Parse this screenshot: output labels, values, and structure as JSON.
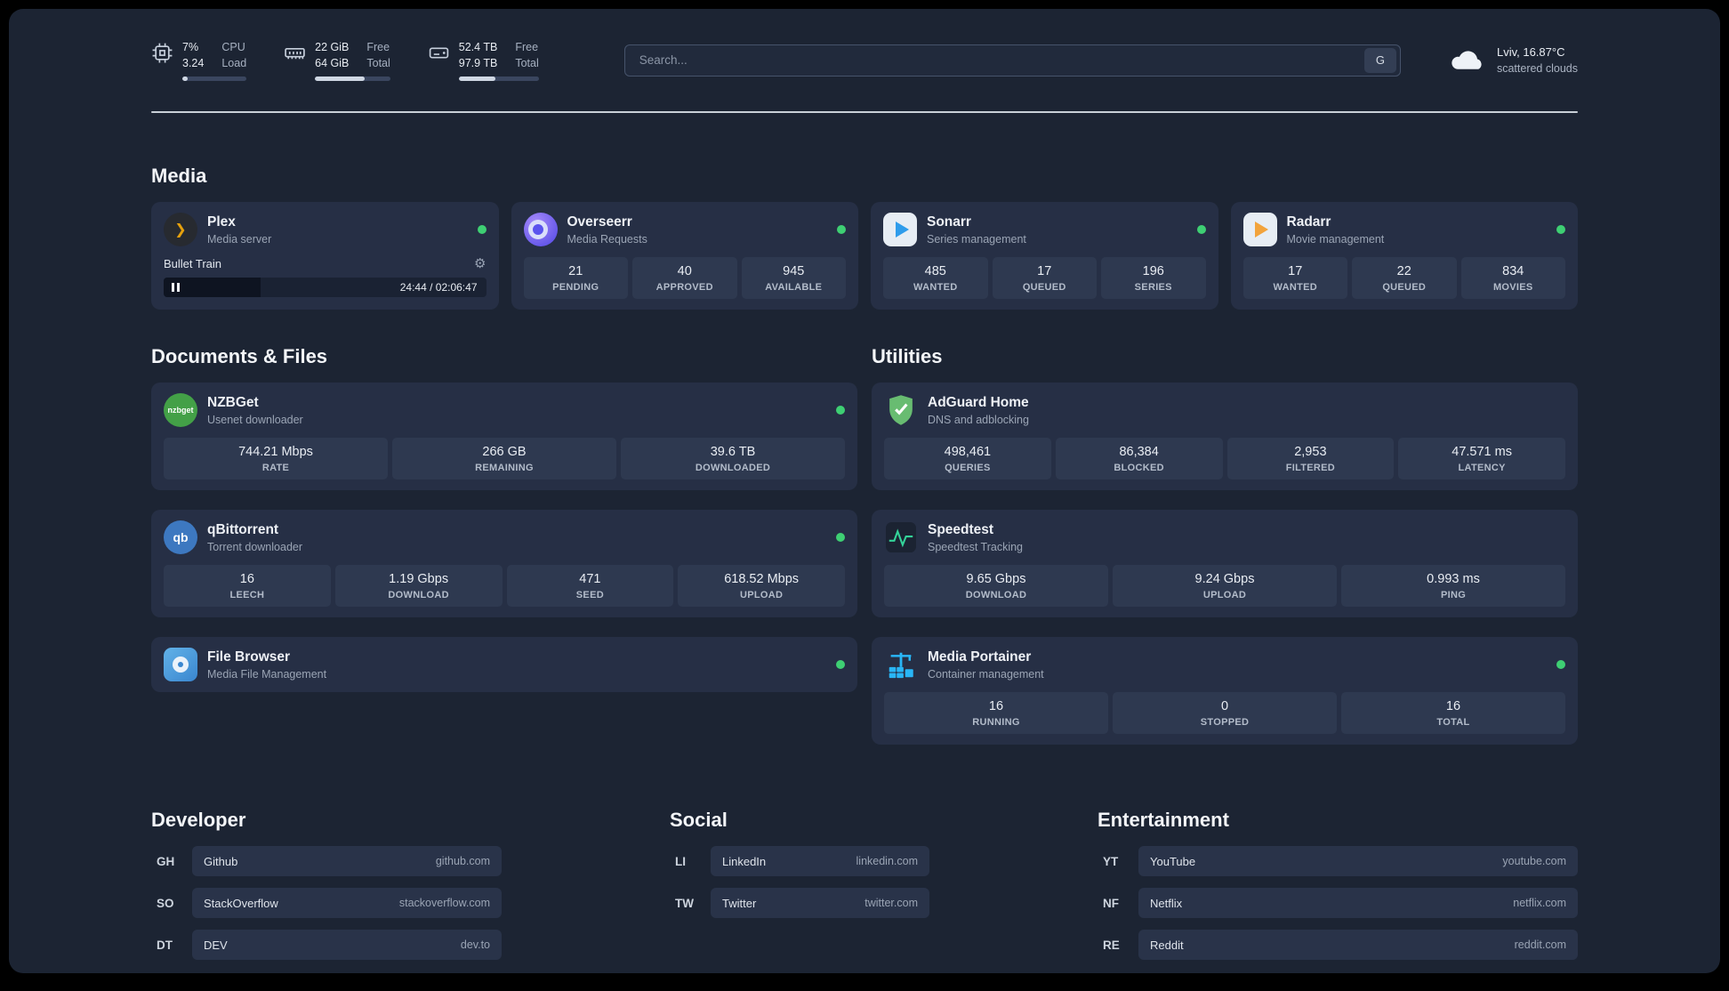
{
  "colors": {
    "background": "#1c2433",
    "card": "#262f45",
    "stat_box": "#2e3950",
    "status_online": "#3ecf73",
    "plex_accent": "#e5a00d",
    "adguard_green": "#68bc71",
    "portainer_blue": "#29b6f6"
  },
  "icons": {
    "gear": "⚙",
    "plex_glyph": "❯",
    "nzbget_text": "nzbget",
    "qbittorrent_text": "qb"
  },
  "topbar": {
    "cpu": {
      "value1": "7%",
      "value2": "3.24",
      "label1": "CPU",
      "label2": "Load"
    },
    "memory": {
      "value1": "22 GiB",
      "value2": "64 GiB",
      "label1": "Free",
      "label2": "Total"
    },
    "disk": {
      "value1": "52.4 TB",
      "value2": "97.9 TB",
      "label1": "Free",
      "label2": "Total"
    },
    "search": {
      "placeholder": "Search...",
      "button": "G"
    },
    "weather": {
      "location": "Lviv, 16.87°C",
      "condition": "scattered clouds"
    }
  },
  "sections": {
    "media": {
      "title": "Media",
      "plex": {
        "name": "Plex",
        "subtitle": "Media server",
        "player": {
          "track": "Bullet Train",
          "time": "24:44 / 02:06:47"
        }
      },
      "overseerr": {
        "name": "Overseerr",
        "subtitle": "Media Requests",
        "stats": [
          {
            "value": "21",
            "label": "PENDING"
          },
          {
            "value": "40",
            "label": "APPROVED"
          },
          {
            "value": "945",
            "label": "AVAILABLE"
          }
        ]
      },
      "sonarr": {
        "name": "Sonarr",
        "subtitle": "Series management",
        "stats": [
          {
            "value": "485",
            "label": "WANTED"
          },
          {
            "value": "17",
            "label": "QUEUED"
          },
          {
            "value": "196",
            "label": "SERIES"
          }
        ]
      },
      "radarr": {
        "name": "Radarr",
        "subtitle": "Movie management",
        "stats": [
          {
            "value": "17",
            "label": "WANTED"
          },
          {
            "value": "22",
            "label": "QUEUED"
          },
          {
            "value": "834",
            "label": "MOVIES"
          }
        ]
      }
    },
    "documents": {
      "title": "Documents & Files",
      "nzbget": {
        "name": "NZBGet",
        "subtitle": "Usenet downloader",
        "stats": [
          {
            "value": "744.21 Mbps",
            "label": "RATE"
          },
          {
            "value": "266 GB",
            "label": "REMAINING"
          },
          {
            "value": "39.6 TB",
            "label": "DOWNLOADED"
          }
        ]
      },
      "qbittorrent": {
        "name": "qBittorrent",
        "subtitle": "Torrent downloader",
        "stats": [
          {
            "value": "16",
            "label": "LEECH"
          },
          {
            "value": "1.19 Gbps",
            "label": "DOWNLOAD"
          },
          {
            "value": "471",
            "label": "SEED"
          },
          {
            "value": "618.52 Mbps",
            "label": "UPLOAD"
          }
        ]
      },
      "filebrowser": {
        "name": "File Browser",
        "subtitle": "Media File Management"
      }
    },
    "utilities": {
      "title": "Utilities",
      "adguard": {
        "name": "AdGuard Home",
        "subtitle": "DNS and adblocking",
        "stats": [
          {
            "value": "498,461",
            "label": "QUERIES"
          },
          {
            "value": "86,384",
            "label": "BLOCKED"
          },
          {
            "value": "2,953",
            "label": "FILTERED"
          },
          {
            "value": "47.571 ms",
            "label": "LATENCY"
          }
        ]
      },
      "speedtest": {
        "name": "Speedtest",
        "subtitle": "Speedtest Tracking",
        "stats": [
          {
            "value": "9.65 Gbps",
            "label": "DOWNLOAD"
          },
          {
            "value": "9.24 Gbps",
            "label": "UPLOAD"
          },
          {
            "value": "0.993 ms",
            "label": "PING"
          }
        ]
      },
      "portainer": {
        "name": "Media Portainer",
        "subtitle": "Container management",
        "stats": [
          {
            "value": "16",
            "label": "RUNNING"
          },
          {
            "value": "0",
            "label": "STOPPED"
          },
          {
            "value": "16",
            "label": "TOTAL"
          }
        ]
      }
    }
  },
  "bookmarks": {
    "developer": {
      "title": "Developer",
      "items": [
        {
          "abbr": "GH",
          "name": "Github",
          "url": "github.com"
        },
        {
          "abbr": "SO",
          "name": "StackOverflow",
          "url": "stackoverflow.com"
        },
        {
          "abbr": "DT",
          "name": "DEV",
          "url": "dev.to"
        }
      ]
    },
    "social": {
      "title": "Social",
      "items": [
        {
          "abbr": "LI",
          "name": "LinkedIn",
          "url": "linkedin.com"
        },
        {
          "abbr": "TW",
          "name": "Twitter",
          "url": "twitter.com"
        }
      ]
    },
    "entertainment": {
      "title": "Entertainment",
      "items": [
        {
          "abbr": "YT",
          "name": "YouTube",
          "url": "youtube.com"
        },
        {
          "abbr": "NF",
          "name": "Netflix",
          "url": "netflix.com"
        },
        {
          "abbr": "RE",
          "name": "Reddit",
          "url": "reddit.com"
        }
      ]
    }
  }
}
